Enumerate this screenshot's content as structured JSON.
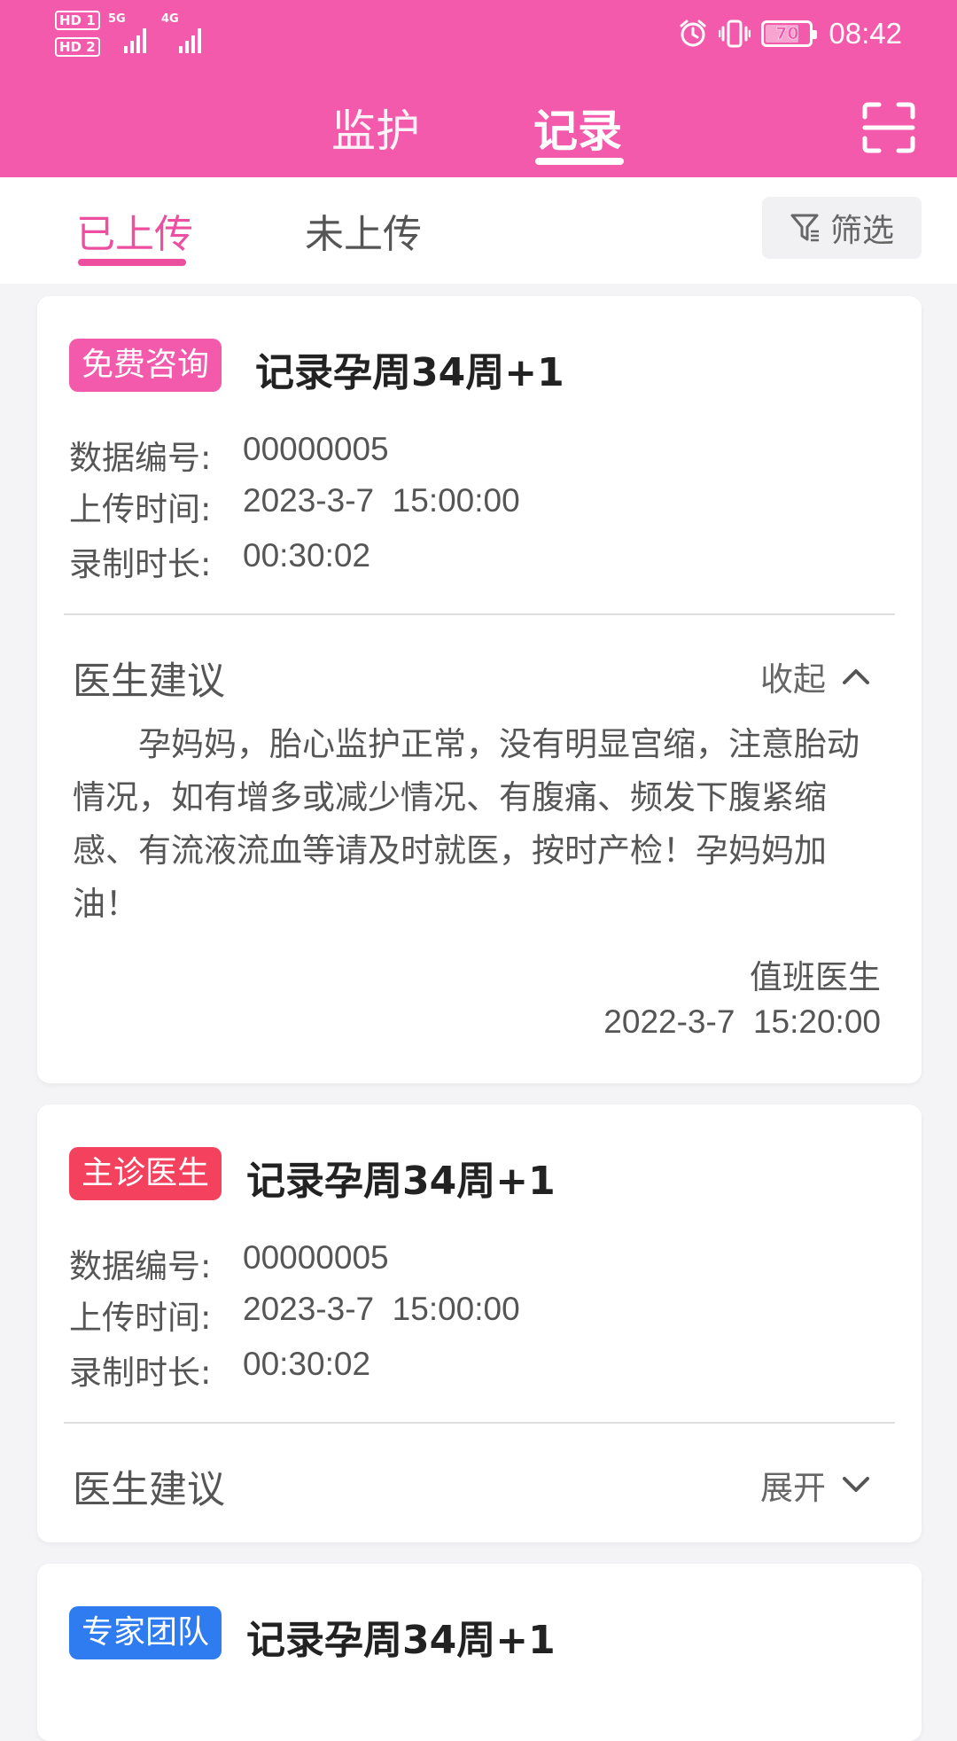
{
  "status_bar": {
    "sim1": "HD 1",
    "sim2": "HD 2",
    "net1": "5G",
    "net2": "4G",
    "battery": "70",
    "time": "08:42"
  },
  "top_tabs": {
    "monitor": "监护",
    "record": "记录",
    "active": "record"
  },
  "sub_tabs": {
    "uploaded": "已上传",
    "not_uploaded": "未上传",
    "active": "uploaded",
    "filter": "筛选"
  },
  "labels": {
    "data_id": "数据编号:",
    "upload_time": "上传时间:",
    "duration": "录制时长:",
    "advice": "医生建议",
    "collapse": "收起",
    "expand": "展开"
  },
  "records": [
    {
      "tag": "免费咨询",
      "tag_color": "#f35aab",
      "title": "记录孕周34周+1",
      "data_id": "00000005",
      "upload_time": "2023-3-7  15:00:00",
      "duration": "00:30:02",
      "expanded": true,
      "advice": "孕妈妈，胎心监护正常，没有明显宫缩，注意胎动情况，如有增多或减少情况、有腹痛、频发下腹紧缩感、有流液流血等请及时就医，按时产检！孕妈妈加油！",
      "doctor": "值班医生",
      "advice_time": "2022-3-7  15:20:00"
    },
    {
      "tag": "主诊医生",
      "tag_color": "#f4425e",
      "title": "记录孕周34周+1",
      "data_id": "00000005",
      "upload_time": "2023-3-7  15:00:00",
      "duration": "00:30:02",
      "expanded": false
    },
    {
      "tag": "专家团队",
      "tag_color": "#2f7bf0",
      "title": "记录孕周34周+1"
    }
  ],
  "colors": {
    "brand": "#f35aab",
    "accent_pink": "#ec4f9f",
    "tag_pink": "#f35aab",
    "tag_red": "#f4425e",
    "tag_blue": "#2f7bf0"
  },
  "icons": {
    "scan": "scan-icon",
    "filter": "filter-icon",
    "collapse": "chevron-up-icon",
    "expand": "chevron-down-icon",
    "alarm": "alarm-icon",
    "vibrate": "vibrate-icon",
    "battery": "battery-icon"
  }
}
